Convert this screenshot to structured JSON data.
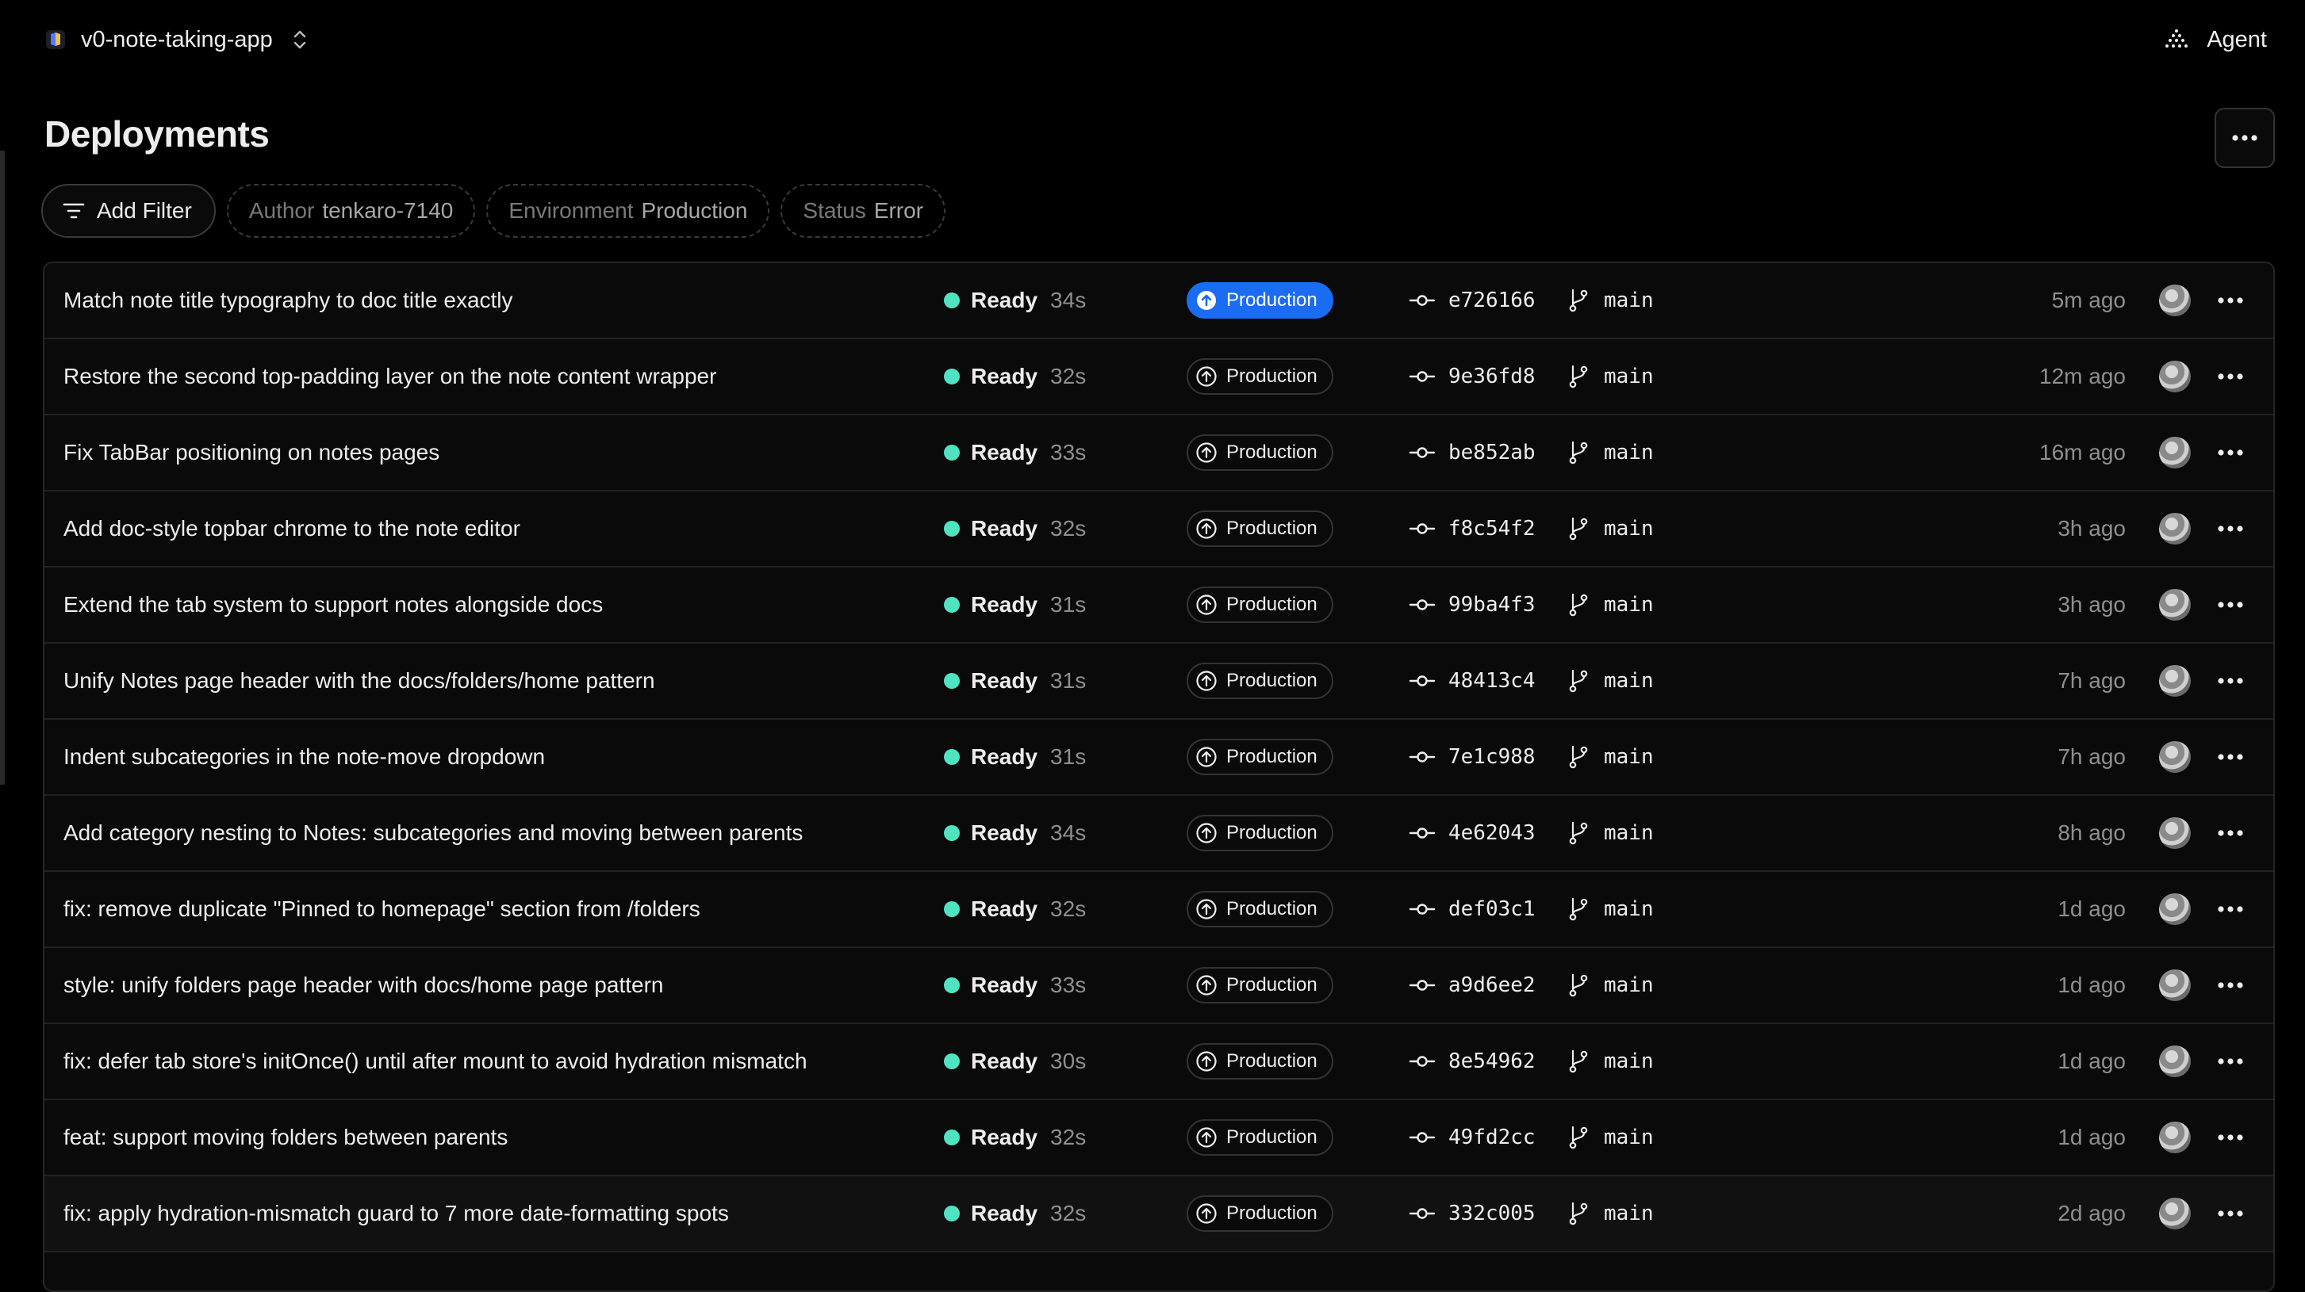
{
  "header": {
    "project_name": "v0-note-taking-app",
    "agent_label": "Agent"
  },
  "page": {
    "title": "Deployments"
  },
  "filters": {
    "add_label": "Add Filter",
    "chips": [
      {
        "key": "Author",
        "value": "tenkaro-7140"
      },
      {
        "key": "Environment",
        "value": "Production"
      },
      {
        "key": "Status",
        "value": "Error"
      }
    ]
  },
  "colors": {
    "ready_dot": "#50e3c2",
    "production_primary": "#1a6cf2"
  },
  "icons": {
    "project": "v0-logo-icon",
    "switcher": "chevron-up-down-icon",
    "agent": "agent-sparkle-icon",
    "filter": "filter-lines-icon",
    "environment": "arrow-up-circle-icon",
    "commit": "git-commit-icon",
    "branch": "git-branch-icon",
    "more": "ellipsis-icon"
  },
  "deployments": [
    {
      "message": "Match note title typography to doc title exactly",
      "status": "Ready",
      "duration": "34s",
      "environment": "Production",
      "commit": "e726166",
      "branch": "main",
      "time": "5m ago"
    },
    {
      "message": "Restore the second top-padding layer on the note content wrapper",
      "status": "Ready",
      "duration": "32s",
      "environment": "Production",
      "commit": "9e36fd8",
      "branch": "main",
      "time": "12m ago"
    },
    {
      "message": "Fix TabBar positioning on notes pages",
      "status": "Ready",
      "duration": "33s",
      "environment": "Production",
      "commit": "be852ab",
      "branch": "main",
      "time": "16m ago"
    },
    {
      "message": "Add doc-style topbar chrome to the note editor",
      "status": "Ready",
      "duration": "32s",
      "environment": "Production",
      "commit": "f8c54f2",
      "branch": "main",
      "time": "3h ago"
    },
    {
      "message": "Extend the tab system to support notes alongside docs",
      "status": "Ready",
      "duration": "31s",
      "environment": "Production",
      "commit": "99ba4f3",
      "branch": "main",
      "time": "3h ago"
    },
    {
      "message": "Unify Notes page header with the docs/folders/home pattern",
      "status": "Ready",
      "duration": "31s",
      "environment": "Production",
      "commit": "48413c4",
      "branch": "main",
      "time": "7h ago"
    },
    {
      "message": "Indent subcategories in the note-move dropdown",
      "status": "Ready",
      "duration": "31s",
      "environment": "Production",
      "commit": "7e1c988",
      "branch": "main",
      "time": "7h ago"
    },
    {
      "message": "Add category nesting to Notes: subcategories and moving between parents",
      "status": "Ready",
      "duration": "34s",
      "environment": "Production",
      "commit": "4e62043",
      "branch": "main",
      "time": "8h ago"
    },
    {
      "message": "fix: remove duplicate \"Pinned to homepage\" section from /folders",
      "status": "Ready",
      "duration": "32s",
      "environment": "Production",
      "commit": "def03c1",
      "branch": "main",
      "time": "1d ago"
    },
    {
      "message": "style: unify folders page header with docs/home page pattern",
      "status": "Ready",
      "duration": "33s",
      "environment": "Production",
      "commit": "a9d6ee2",
      "branch": "main",
      "time": "1d ago"
    },
    {
      "message": "fix: defer tab store's initOnce() until after mount to avoid hydration mismatch",
      "status": "Ready",
      "duration": "30s",
      "environment": "Production",
      "commit": "8e54962",
      "branch": "main",
      "time": "1d ago"
    },
    {
      "message": "feat: support moving folders between parents",
      "status": "Ready",
      "duration": "32s",
      "environment": "Production",
      "commit": "49fd2cc",
      "branch": "main",
      "time": "1d ago"
    },
    {
      "message": "fix: apply hydration-mismatch guard to 7 more date-formatting spots",
      "status": "Ready",
      "duration": "32s",
      "environment": "Production",
      "commit": "332c005",
      "branch": "main",
      "time": "2d ago"
    }
  ]
}
